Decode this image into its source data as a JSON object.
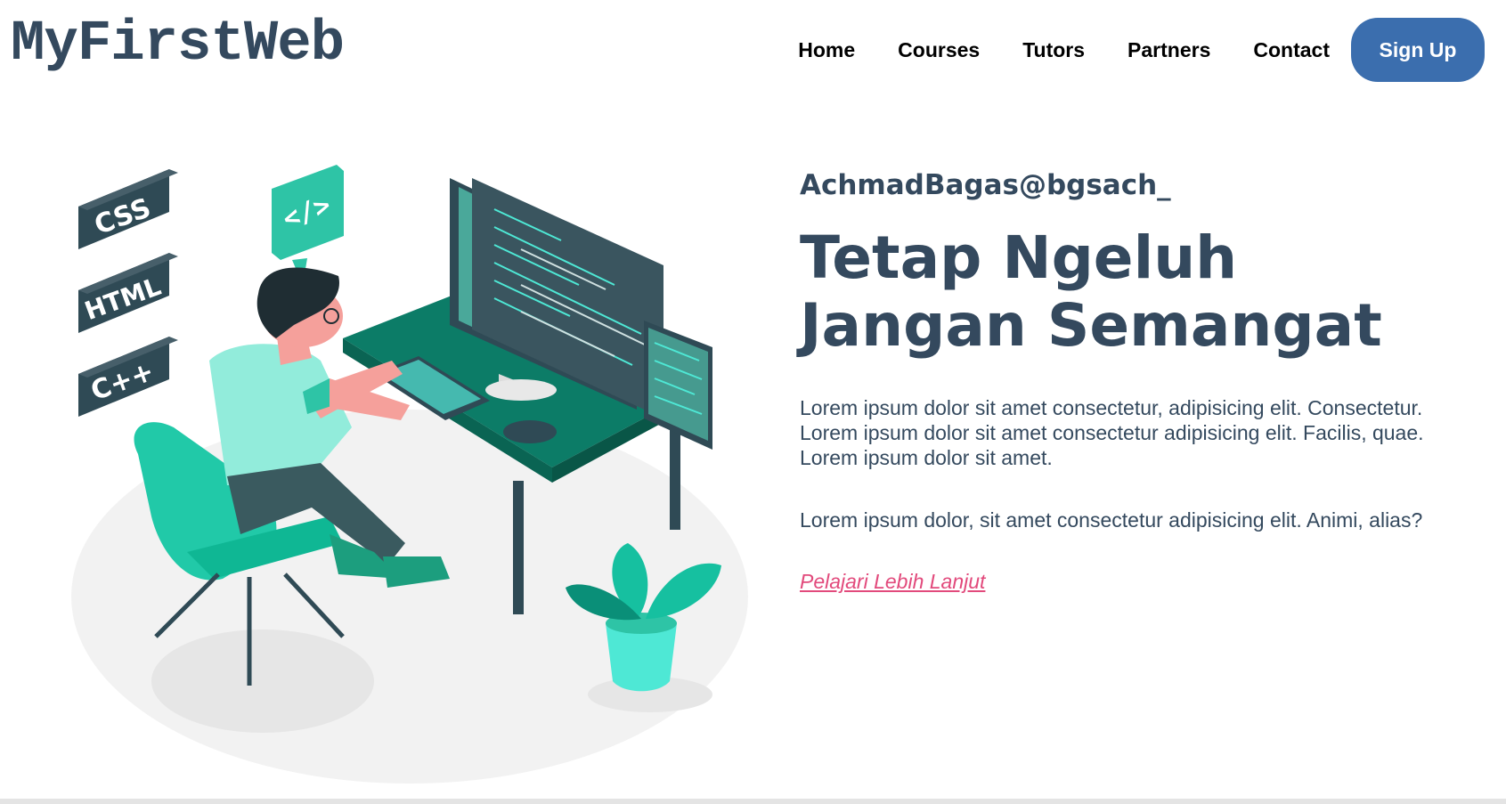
{
  "header": {
    "logo": "MyFirstWeb",
    "nav": [
      "Home",
      "Courses",
      "Tutors",
      "Partners",
      "Contact"
    ],
    "signup_label": "Sign Up"
  },
  "hero": {
    "handle": "AchmadBagas@bgsach_",
    "headline": "Tetap Ngeluh Jangan Semangat",
    "paragraph1": "Lorem ipsum dolor sit amet consectetur, adipisicing elit. Consectetur. Lorem ipsum dolor sit amet consectetur adipisicing elit. Facilis, quae. Lorem ipsum dolor sit amet.",
    "paragraph2": "Lorem ipsum dolor, sit amet consectetur adipisicing elit. Animi, alias?",
    "cta": "Pelajari Lebih Lanjut"
  },
  "illustration": {
    "blocks": [
      "CSS",
      "HTML",
      "C++"
    ],
    "code_badge": "</>"
  },
  "colors": {
    "brand": "#34495e",
    "button": "#3b6eae",
    "link": "#e24a7c",
    "teal": "#00c9a7",
    "teal_dark": "#0c7c67"
  }
}
